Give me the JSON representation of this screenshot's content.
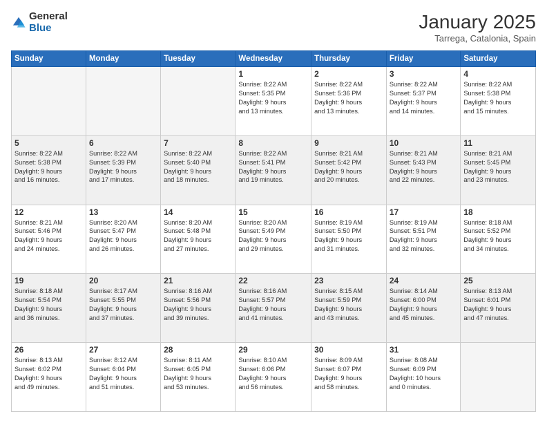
{
  "logo": {
    "general": "General",
    "blue": "Blue"
  },
  "header": {
    "month": "January 2025",
    "location": "Tarrega, Catalonia, Spain"
  },
  "weekdays": [
    "Sunday",
    "Monday",
    "Tuesday",
    "Wednesday",
    "Thursday",
    "Friday",
    "Saturday"
  ],
  "weeks": [
    [
      {
        "day": "",
        "info": ""
      },
      {
        "day": "",
        "info": ""
      },
      {
        "day": "",
        "info": ""
      },
      {
        "day": "1",
        "info": "Sunrise: 8:22 AM\nSunset: 5:35 PM\nDaylight: 9 hours\nand 13 minutes."
      },
      {
        "day": "2",
        "info": "Sunrise: 8:22 AM\nSunset: 5:36 PM\nDaylight: 9 hours\nand 13 minutes."
      },
      {
        "day": "3",
        "info": "Sunrise: 8:22 AM\nSunset: 5:37 PM\nDaylight: 9 hours\nand 14 minutes."
      },
      {
        "day": "4",
        "info": "Sunrise: 8:22 AM\nSunset: 5:38 PM\nDaylight: 9 hours\nand 15 minutes."
      }
    ],
    [
      {
        "day": "5",
        "info": "Sunrise: 8:22 AM\nSunset: 5:38 PM\nDaylight: 9 hours\nand 16 minutes."
      },
      {
        "day": "6",
        "info": "Sunrise: 8:22 AM\nSunset: 5:39 PM\nDaylight: 9 hours\nand 17 minutes."
      },
      {
        "day": "7",
        "info": "Sunrise: 8:22 AM\nSunset: 5:40 PM\nDaylight: 9 hours\nand 18 minutes."
      },
      {
        "day": "8",
        "info": "Sunrise: 8:22 AM\nSunset: 5:41 PM\nDaylight: 9 hours\nand 19 minutes."
      },
      {
        "day": "9",
        "info": "Sunrise: 8:21 AM\nSunset: 5:42 PM\nDaylight: 9 hours\nand 20 minutes."
      },
      {
        "day": "10",
        "info": "Sunrise: 8:21 AM\nSunset: 5:43 PM\nDaylight: 9 hours\nand 22 minutes."
      },
      {
        "day": "11",
        "info": "Sunrise: 8:21 AM\nSunset: 5:45 PM\nDaylight: 9 hours\nand 23 minutes."
      }
    ],
    [
      {
        "day": "12",
        "info": "Sunrise: 8:21 AM\nSunset: 5:46 PM\nDaylight: 9 hours\nand 24 minutes."
      },
      {
        "day": "13",
        "info": "Sunrise: 8:20 AM\nSunset: 5:47 PM\nDaylight: 9 hours\nand 26 minutes."
      },
      {
        "day": "14",
        "info": "Sunrise: 8:20 AM\nSunset: 5:48 PM\nDaylight: 9 hours\nand 27 minutes."
      },
      {
        "day": "15",
        "info": "Sunrise: 8:20 AM\nSunset: 5:49 PM\nDaylight: 9 hours\nand 29 minutes."
      },
      {
        "day": "16",
        "info": "Sunrise: 8:19 AM\nSunset: 5:50 PM\nDaylight: 9 hours\nand 31 minutes."
      },
      {
        "day": "17",
        "info": "Sunrise: 8:19 AM\nSunset: 5:51 PM\nDaylight: 9 hours\nand 32 minutes."
      },
      {
        "day": "18",
        "info": "Sunrise: 8:18 AM\nSunset: 5:52 PM\nDaylight: 9 hours\nand 34 minutes."
      }
    ],
    [
      {
        "day": "19",
        "info": "Sunrise: 8:18 AM\nSunset: 5:54 PM\nDaylight: 9 hours\nand 36 minutes."
      },
      {
        "day": "20",
        "info": "Sunrise: 8:17 AM\nSunset: 5:55 PM\nDaylight: 9 hours\nand 37 minutes."
      },
      {
        "day": "21",
        "info": "Sunrise: 8:16 AM\nSunset: 5:56 PM\nDaylight: 9 hours\nand 39 minutes."
      },
      {
        "day": "22",
        "info": "Sunrise: 8:16 AM\nSunset: 5:57 PM\nDaylight: 9 hours\nand 41 minutes."
      },
      {
        "day": "23",
        "info": "Sunrise: 8:15 AM\nSunset: 5:59 PM\nDaylight: 9 hours\nand 43 minutes."
      },
      {
        "day": "24",
        "info": "Sunrise: 8:14 AM\nSunset: 6:00 PM\nDaylight: 9 hours\nand 45 minutes."
      },
      {
        "day": "25",
        "info": "Sunrise: 8:13 AM\nSunset: 6:01 PM\nDaylight: 9 hours\nand 47 minutes."
      }
    ],
    [
      {
        "day": "26",
        "info": "Sunrise: 8:13 AM\nSunset: 6:02 PM\nDaylight: 9 hours\nand 49 minutes."
      },
      {
        "day": "27",
        "info": "Sunrise: 8:12 AM\nSunset: 6:04 PM\nDaylight: 9 hours\nand 51 minutes."
      },
      {
        "day": "28",
        "info": "Sunrise: 8:11 AM\nSunset: 6:05 PM\nDaylight: 9 hours\nand 53 minutes."
      },
      {
        "day": "29",
        "info": "Sunrise: 8:10 AM\nSunset: 6:06 PM\nDaylight: 9 hours\nand 56 minutes."
      },
      {
        "day": "30",
        "info": "Sunrise: 8:09 AM\nSunset: 6:07 PM\nDaylight: 9 hours\nand 58 minutes."
      },
      {
        "day": "31",
        "info": "Sunrise: 8:08 AM\nSunset: 6:09 PM\nDaylight: 10 hours\nand 0 minutes."
      },
      {
        "day": "",
        "info": ""
      }
    ]
  ]
}
